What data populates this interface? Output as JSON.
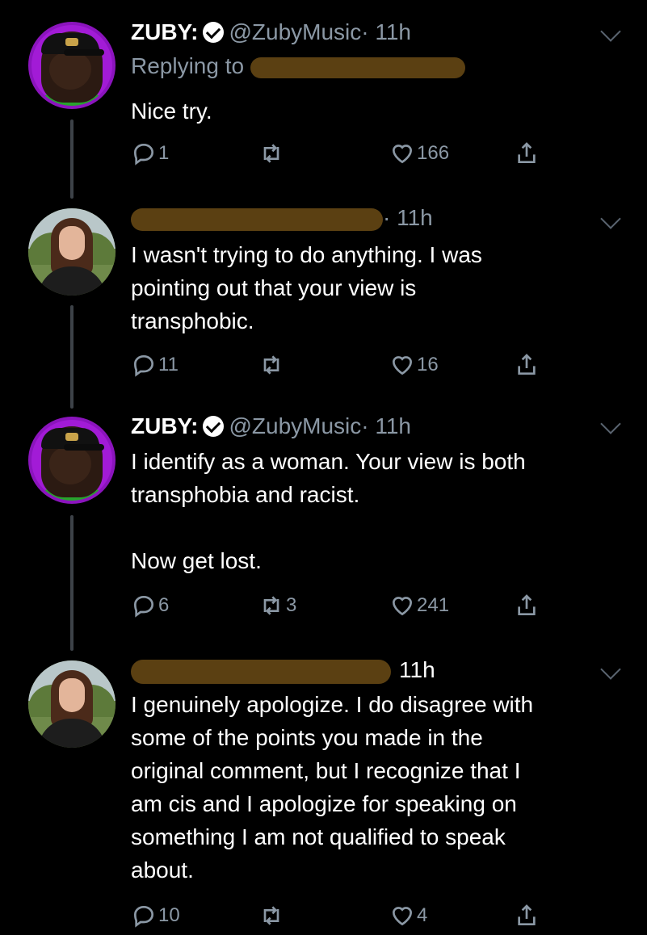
{
  "tweets": [
    {
      "name": "ZUBY:",
      "handle": "@ZubyMusic",
      "time": "· 11h",
      "replying_to": "Replying to",
      "text": "Nice try.",
      "replies": "1",
      "retweets": "",
      "likes": "166",
      "avatar_icon": "zuby-avatar"
    },
    {
      "name": "",
      "handle": "",
      "time": "· 11h",
      "text": "I wasn't trying to do anything. I was\npointing out that your view is\ntransphobic.",
      "replies": "11",
      "retweets": "",
      "likes": "16",
      "avatar_icon": "woman-avatar"
    },
    {
      "name": "ZUBY:",
      "handle": "@ZubyMusic",
      "time": "· 11h",
      "text": "I identify as a woman. Your view is both\ntransphobia and racist.\n\nNow get lost.",
      "replies": "6",
      "retweets": "3",
      "likes": "241",
      "avatar_icon": "zuby-avatar"
    },
    {
      "name": "",
      "handle": "",
      "time": "11h",
      "text": "I genuinely apologize. I do disagree with\nsome of the points you made in  the\noriginal comment, but I recognize that I\nam cis and I apologize for speaking on\nsomething I am not qualified to speak\nabout.",
      "replies": "10",
      "retweets": "",
      "likes": "4",
      "avatar_icon": "woman-avatar"
    }
  ],
  "colors": {
    "background": "#000000",
    "text": "#ffffff",
    "secondary": "#8b98a5",
    "redaction": "#5b4012",
    "zuby_avatar_ring": "#a21bd6"
  }
}
